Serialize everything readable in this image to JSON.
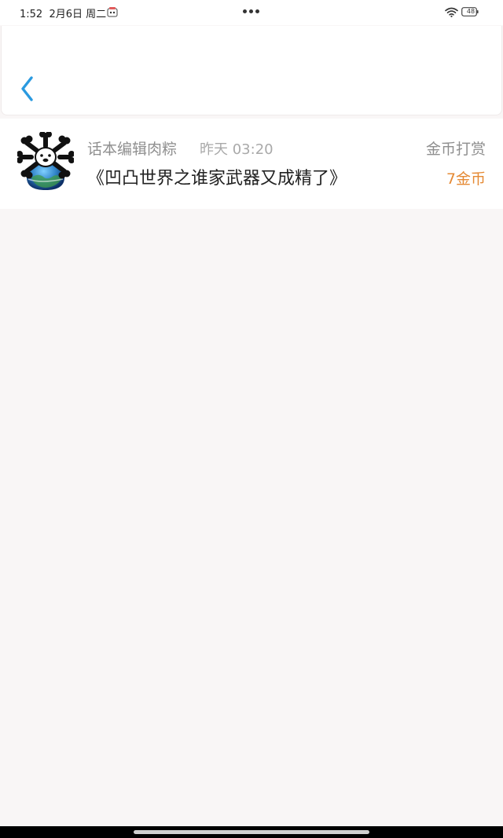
{
  "status_bar": {
    "time": "1:52",
    "date": "2月6日 周二",
    "battery": "48",
    "icons": [
      "notification-icon",
      "more-icon",
      "wifi-icon",
      "battery-icon"
    ]
  },
  "nav": {
    "back_icon": "chevron-left-icon",
    "accent_color": "#2a9ae0"
  },
  "rewards": [
    {
      "user_name": "话本编辑肉粽",
      "time": "昨天 03:20",
      "type": "金币打赏",
      "title": "《凹凸世界之谁家武器又成精了》",
      "amount": "7金币"
    }
  ],
  "colors": {
    "amount": "#e58a35",
    "background": "#f9f6f6"
  }
}
